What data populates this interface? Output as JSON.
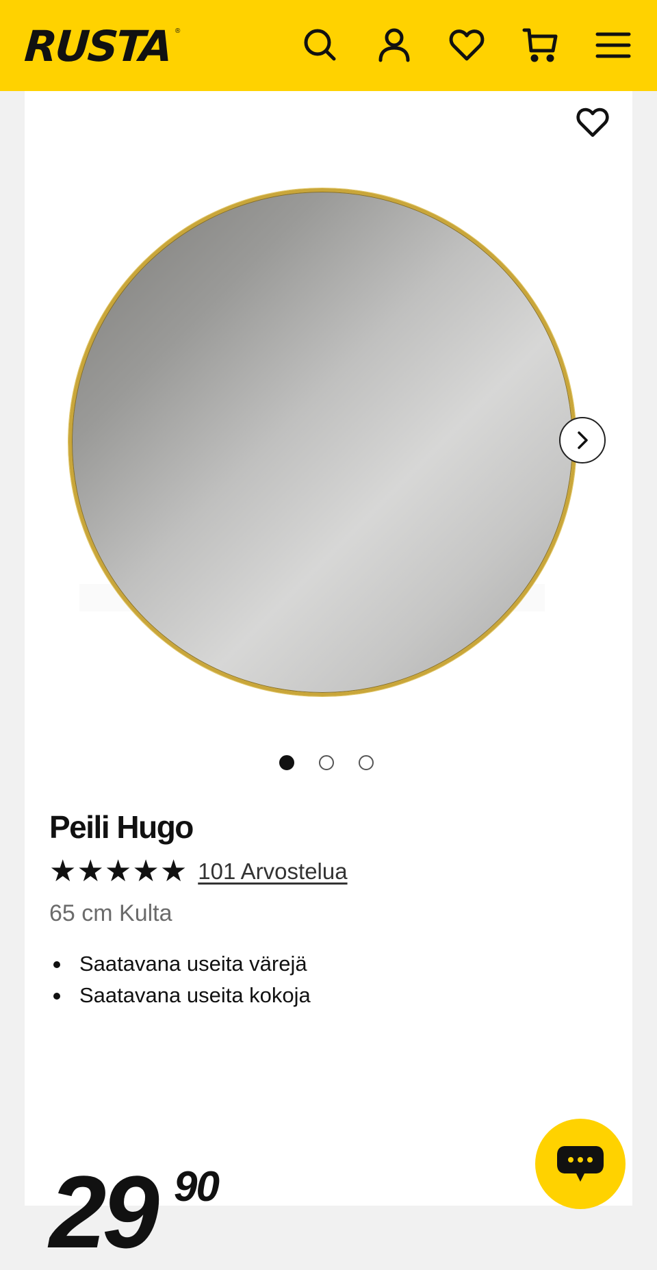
{
  "header": {
    "logo_text": "RUSTA",
    "logo_mark": "®",
    "background_color": "#ffd200",
    "icons": [
      "search-icon",
      "user-icon",
      "heart-icon",
      "cart-icon",
      "menu-icon"
    ]
  },
  "product": {
    "image_alt": "Round mirror with gold frame",
    "gallery": {
      "slide_count": 3,
      "active_slide": 1
    },
    "title": "Peili Hugo",
    "rating": {
      "stars": 5,
      "star_glyphs": "★★★★★",
      "reviews_text": "101 Arvostelua"
    },
    "variant": "65 cm Kulta",
    "features": [
      "Saatavana useita värejä",
      "Saatavana useita kokoja"
    ],
    "price": {
      "integer": "29",
      "decimal": "90"
    }
  },
  "chat": {
    "icon": "chat-icon"
  }
}
